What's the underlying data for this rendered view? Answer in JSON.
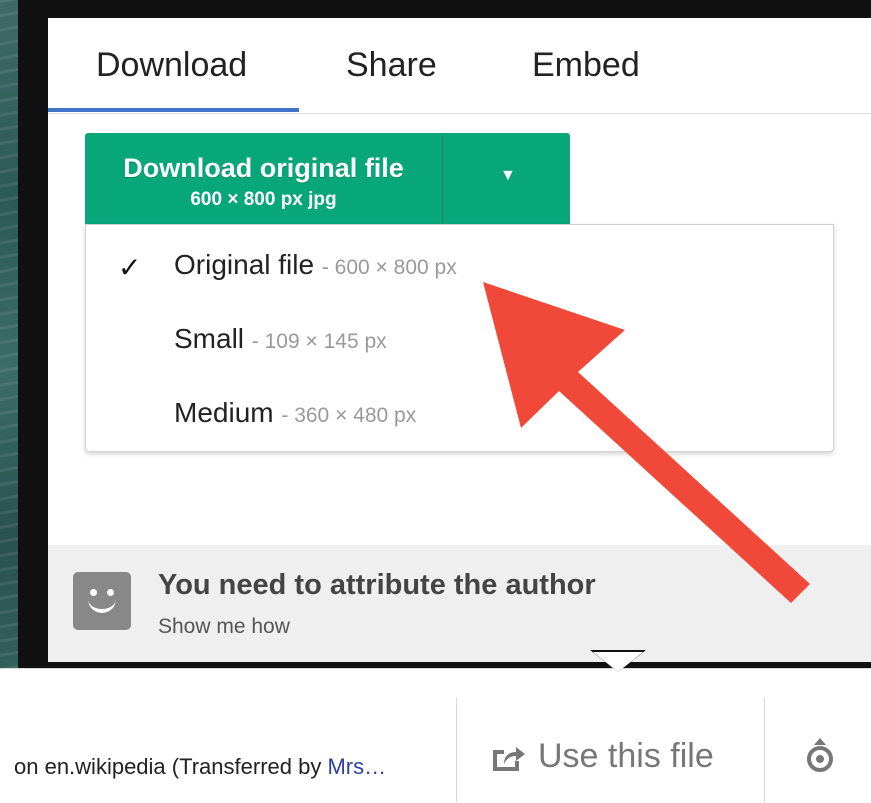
{
  "tabs": [
    {
      "label": "Download",
      "active": true
    },
    {
      "label": "Share",
      "active": false
    },
    {
      "label": "Embed",
      "active": false
    }
  ],
  "download_button": {
    "label": "Download original file",
    "sublabel": "600 × 800 px jpg",
    "color": "#08a77a"
  },
  "menu": {
    "items": [
      {
        "name": "Original file",
        "dims": "- 600 × 800 px",
        "checked": true
      },
      {
        "name": "Small",
        "dims": "- 109 × 145 px",
        "checked": false
      },
      {
        "name": "Medium",
        "dims": "- 360 × 480 px",
        "checked": false
      }
    ],
    "check_mark": "✓"
  },
  "attribution": {
    "title": "You need to attribute the author",
    "link": "Show me how"
  },
  "footer": {
    "credit_prefix": "on en.wikipedia (Transferred by ",
    "credit_user": "Mrs…",
    "use_file_label": "Use this file"
  },
  "colors": {
    "accent_tab": "#3f74c9",
    "annotation_arrow": "#f0493a"
  },
  "icons": [
    "smile-icon",
    "share-icon",
    "wikimedia-icon",
    "caret-down-icon",
    "check-icon"
  ]
}
